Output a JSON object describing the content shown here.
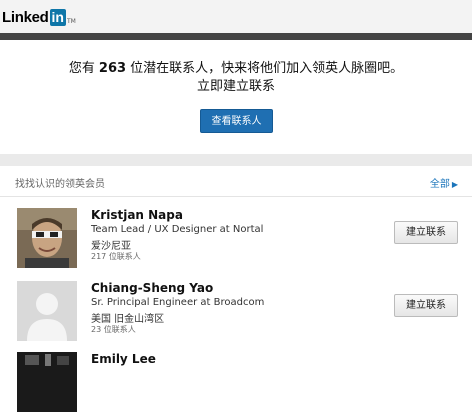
{
  "header": {
    "logo_text": "Linked",
    "logo_in": "in",
    "logo_tm": "TM"
  },
  "promo": {
    "line1_before": "您有",
    "count": "263",
    "line1_after": "位潜在联系人，快来将他们加入领英人脉圈吧。",
    "line2": "立即建立联系",
    "button_label": "查看联系人"
  },
  "pymk": {
    "title": "找找认识的领英会员",
    "see_all_label": "全部",
    "people": [
      {
        "name": "Kristjan Napa",
        "title": "Team Lead / UX Designer at Nortal",
        "location": "爱沙尼亚",
        "connections": "217 位联系人",
        "button_label": "建立联系"
      },
      {
        "name": "Chiang-Sheng Yao",
        "title": "Sr. Principal Engineer at Broadcom",
        "location": "美国 旧金山湾区",
        "connections": "23 位联系人",
        "button_label": "建立联系"
      },
      {
        "name": "Emily Lee"
      }
    ]
  },
  "colors": {
    "brand_blue": "#0e76a8",
    "button_blue": "#1f6fb2",
    "link_blue": "#1b75bb"
  }
}
